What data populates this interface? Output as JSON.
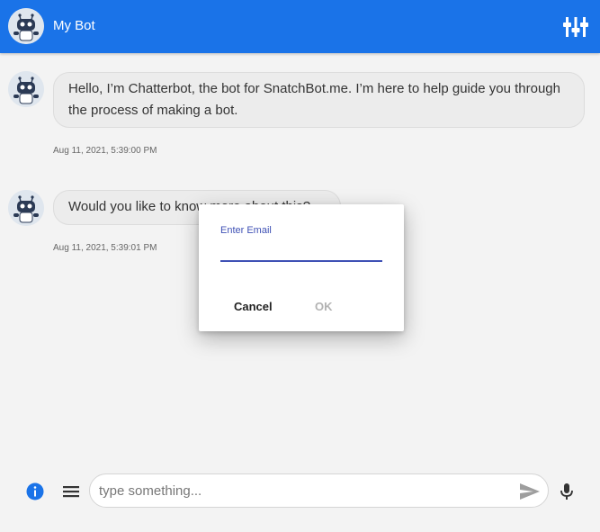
{
  "header": {
    "title": "My Bot",
    "avatar_icon": "robot-avatar-icon",
    "settings_icon": "sliders-icon",
    "color": "#1a73e8"
  },
  "messages": [
    {
      "text": "Hello, I’m Chatterbot, the bot for SnatchBot.me. I’m here to help guide you through the process of making a bot.",
      "timestamp": "Aug 11, 2021, 5:39:00 PM"
    },
    {
      "text": "Would you like to know more about this?",
      "timestamp": "Aug 11, 2021, 5:39:01 PM"
    }
  ],
  "dialog": {
    "label": "Enter Email",
    "value": "",
    "cancel_label": "Cancel",
    "ok_label": "OK",
    "accent_color": "#3f51b5"
  },
  "composer": {
    "placeholder": "type something...",
    "value": "",
    "info_icon": "info-icon",
    "menu_icon": "hamburger-menu-icon",
    "send_icon": "send-icon",
    "mic_icon": "microphone-icon"
  }
}
